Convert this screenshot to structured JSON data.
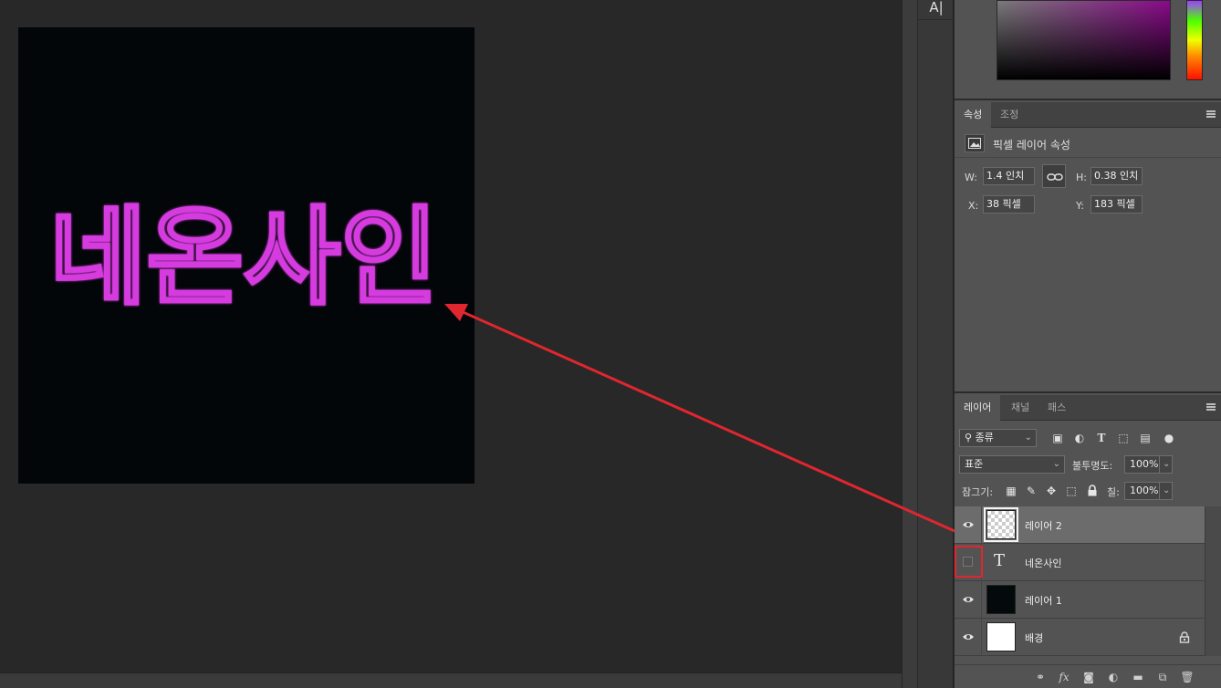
{
  "canvas": {
    "text": "네온사인",
    "neon_color": "#d63adf",
    "background_color": "#020608"
  },
  "tools": {
    "character_tool_glyph": "A|"
  },
  "properties_panel": {
    "tabs": [
      {
        "label": "속성",
        "active": true
      },
      {
        "label": "조정",
        "active": false
      }
    ],
    "title": "픽셀 레이어 속성",
    "w_label": "W:",
    "w_value": "1.4 인치",
    "h_label": "H:",
    "h_value": "0.38 인치",
    "x_label": "X:",
    "x_value": "38 픽셀",
    "y_label": "Y:",
    "y_value": "183 픽셀"
  },
  "layers_panel": {
    "tabs": [
      {
        "label": "레이어",
        "active": true
      },
      {
        "label": "채널",
        "active": false
      },
      {
        "label": "패스",
        "active": false
      }
    ],
    "filter_kind": "종류",
    "blend_mode": "표준",
    "opacity_label": "불투명도:",
    "opacity_value": "100%",
    "lock_label": "잠그기:",
    "fill_label": "칠:",
    "fill_value": "100%",
    "layers": [
      {
        "name": "레이어 2",
        "visible": true,
        "selected": true,
        "thumbnail": "transparent-checker"
      },
      {
        "name": "네온사인",
        "visible": false,
        "selected": false,
        "thumbnail": "type-layer"
      },
      {
        "name": "레이어 1",
        "visible": true,
        "selected": false,
        "thumbnail": "black"
      },
      {
        "name": "배경",
        "visible": true,
        "selected": false,
        "thumbnail": "white",
        "locked": true
      }
    ]
  },
  "annotation": {
    "color": "#e0262e"
  }
}
